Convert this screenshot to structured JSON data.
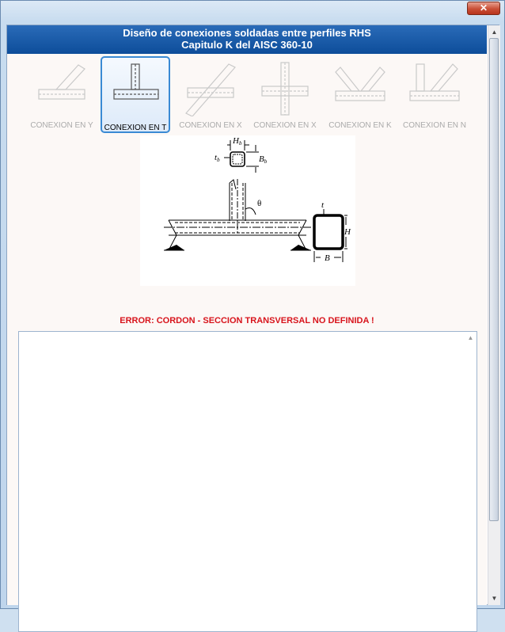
{
  "window": {
    "close_label": "✕"
  },
  "header": {
    "title_line1": "Diseño de conexiones soldadas entre perfiles RHS",
    "title_line2": "Capitulo K del AISC 360-10"
  },
  "tabs": [
    {
      "label": "CONEXION EN Y",
      "icon": "y-connection-icon",
      "active": false
    },
    {
      "label": "CONEXION EN T",
      "icon": "t-connection-icon",
      "active": true
    },
    {
      "label": "CONEXION EN X",
      "icon": "x-connection-icon",
      "active": false
    },
    {
      "label": "CONEXION EN X",
      "icon": "cross-connection-icon",
      "active": false
    },
    {
      "label": "CONEXION EN K",
      "icon": "k-connection-icon",
      "active": false
    },
    {
      "label": "CONEXION EN N",
      "icon": "n-connection-icon",
      "active": false
    }
  ],
  "diagram": {
    "labels": {
      "hb": "H",
      "hb_sub": "b",
      "tb": "t",
      "tb_sub": "b",
      "bb": "B",
      "bb_sub": "b",
      "theta": "θ",
      "t": "t",
      "h": "H",
      "b": "B"
    }
  },
  "status": {
    "error_text": "ERROR: CORDON - SECCION TRANSVERSAL NO DEFINIDA !"
  },
  "output": {
    "text": ""
  },
  "colors": {
    "accent": "#0d4d9a",
    "error": "#d8141c",
    "active_tab_border": "#3a8ad4"
  }
}
